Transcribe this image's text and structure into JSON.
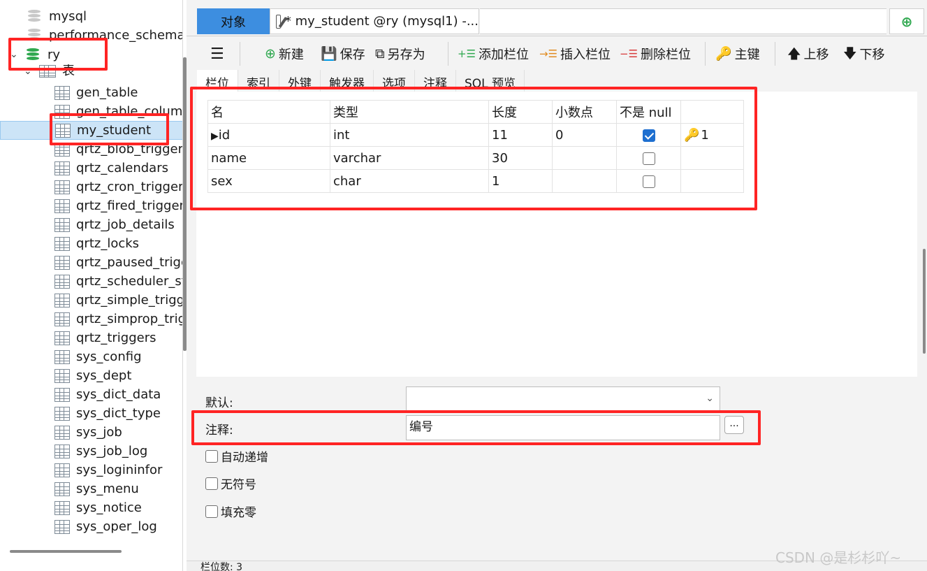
{
  "sidebar": {
    "databases": [
      {
        "label": "mysql"
      },
      {
        "label": "performance_schema"
      },
      {
        "label": "ry"
      }
    ],
    "group_label": "表",
    "tables": [
      "gen_table",
      "gen_table_column",
      "my_student",
      "qrtz_blob_triggers",
      "qrtz_calendars",
      "qrtz_cron_triggers",
      "qrtz_fired_triggers",
      "qrtz_job_details",
      "qrtz_locks",
      "qrtz_paused_trigger_grps",
      "qrtz_scheduler_state",
      "qrtz_simple_triggers",
      "qrtz_simprop_triggers",
      "qrtz_triggers",
      "sys_config",
      "sys_dept",
      "sys_dict_data",
      "sys_dict_type",
      "sys_job",
      "sys_job_log",
      "sys_logininfor",
      "sys_menu",
      "sys_notice",
      "sys_oper_log"
    ],
    "selected_table": "my_student"
  },
  "tabs": {
    "object_tab": "对象",
    "doc_tab": "* my_student @ry (mysql1) -..."
  },
  "toolbar": {
    "new": "新建",
    "save": "保存",
    "save_as": "另存为",
    "add_column": "添加栏位",
    "insert_column": "插入栏位",
    "delete_column": "删除栏位",
    "primary_key": "主键",
    "move_up": "上移",
    "move_down": "下移"
  },
  "subtabs": [
    "栏位",
    "索引",
    "外键",
    "触发器",
    "选项",
    "注释",
    "SQL 预览"
  ],
  "columns_table": {
    "headers": [
      "名",
      "类型",
      "长度",
      "小数点",
      "不是 null",
      ""
    ],
    "rows": [
      {
        "name": "id",
        "type": "int",
        "length": "11",
        "decimals": "0",
        "not_null": true,
        "key": "1"
      },
      {
        "name": "name",
        "type": "varchar",
        "length": "30",
        "decimals": "",
        "not_null": false,
        "key": ""
      },
      {
        "name": "sex",
        "type": "char",
        "length": "1",
        "decimals": "",
        "not_null": false,
        "key": ""
      }
    ]
  },
  "props": {
    "default_label": "默认:",
    "default_value": "",
    "comment_label": "注释:",
    "comment_value": "编号",
    "more_button": "...",
    "auto_increment": "自动递增",
    "unsigned": "无符号",
    "zerofill": "填充零"
  },
  "status": {
    "text": "栏位数: 3"
  },
  "watermark": "CSDN @是杉杉吖~",
  "colors": {
    "accent_tab": "#3d8ee0",
    "annotation_red": "#ff2424",
    "checkbox_on": "#1e6fd0",
    "db_active": "#2fa84f"
  }
}
